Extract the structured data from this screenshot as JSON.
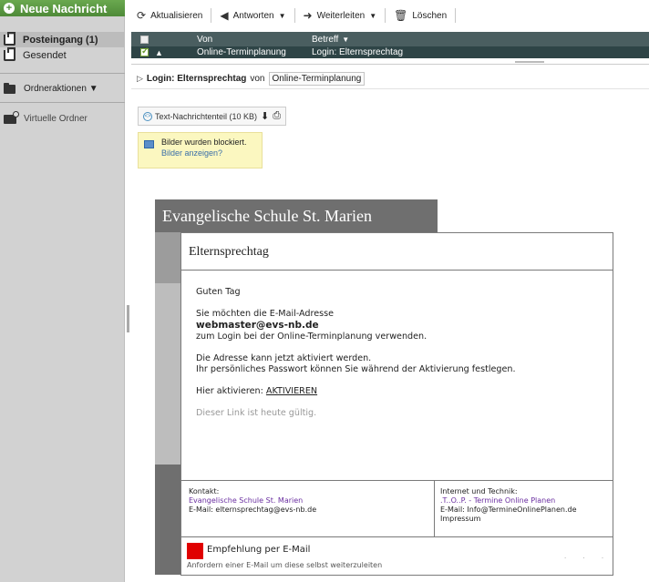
{
  "sidebar": {
    "new_message": "Neue Nachricht",
    "folders": [
      {
        "label": "Posteingang (1)",
        "active": true
      },
      {
        "label": "Gesendet",
        "active": false
      }
    ],
    "folder_actions": "Ordneraktionen ▼",
    "virtual_folders": "Virtuelle Ordner"
  },
  "toolbar": {
    "refresh": "Aktualisieren",
    "reply": "Antworten",
    "forward": "Weiterleiten",
    "delete": "Löschen"
  },
  "list": {
    "col_from": "Von",
    "col_subject": "Betreff",
    "rows": [
      {
        "from": "Online-Terminplanung",
        "subject": "Login: Elternsprechtag",
        "selected": true
      }
    ]
  },
  "message": {
    "subject": "Login: Elternsprechtag",
    "from_word": "von",
    "sender": "Online-Terminplanung",
    "attachment": "Text-Nachrichtenteil (10 KB)",
    "blocked_line1": "Bilder wurden blockiert.",
    "blocked_line2": "Bilder anzeigen?"
  },
  "email": {
    "school": "Evangelische Schule St. Marien",
    "title": "Elternsprechtag",
    "greeting": "Guten Tag",
    "line1": "Sie möchten die E-Mail-Adresse",
    "address": "webmaster@evs-nb.de",
    "line2": "zum Login bei der Online-Terminplanung verwenden.",
    "line3": "Die Adresse kann jetzt aktiviert werden.",
    "line4": "Ihr persönliches Passwort können Sie während der Aktivierung festlegen.",
    "activate_prefix": "Hier aktivieren:",
    "activate_link": "AKTIVIEREN",
    "valid_note": "Dieser Link ist heute gültig.",
    "contact_label": "Kontakt:",
    "contact_name": "Evangelische Schule St. Marien",
    "contact_mail": "E-Mail: elternsprechtag@evs-nb.de",
    "tech_label": "Internet und Technik:",
    "tech_name": ".T..O..P. - Termine Online Planen",
    "tech_mail": "E-Mail: Info@TermineOnlinePlanen.de",
    "imprint": "Impressum",
    "recommend_title": "Empfehlung per E-Mail",
    "recommend_sub": "Anfordern einer E-Mail um diese selbst weiterzuleiten",
    "recommend_dots": ". . ."
  },
  "colors": {
    "new_message_green": "#4e8a38",
    "list_header": "#4a5e60",
    "list_row_selected": "#2e4446",
    "school_header": "#6f6f6f",
    "recommend_red": "#e00000",
    "link_purple": "#6a2fa0"
  }
}
